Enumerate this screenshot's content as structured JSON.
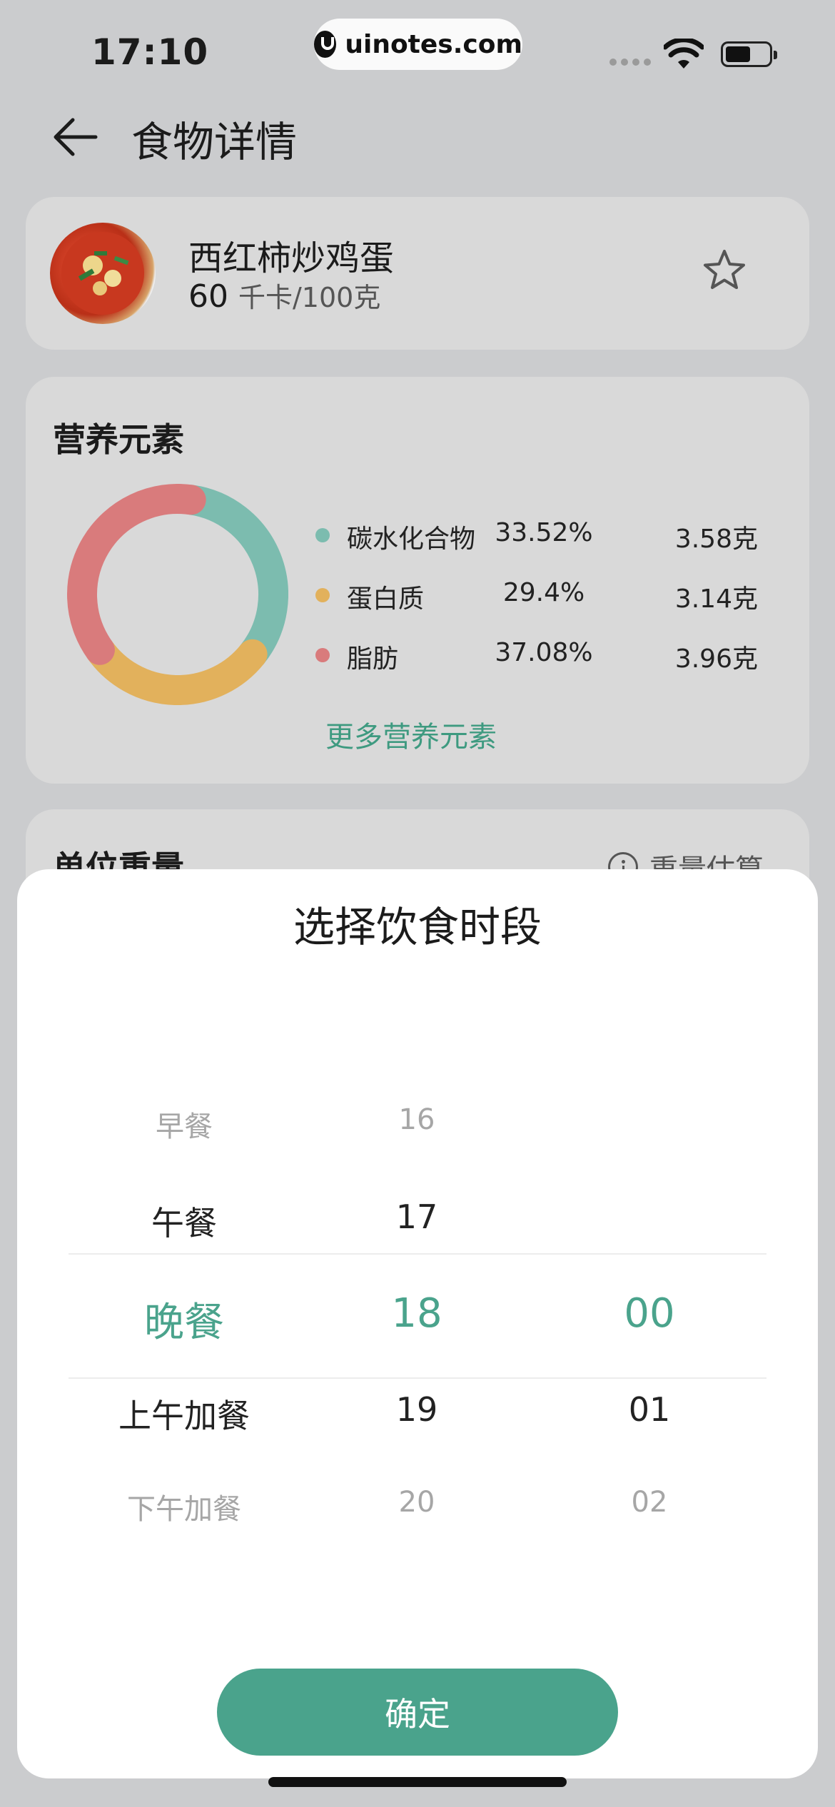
{
  "status_bar": {
    "time": "17:10",
    "site": "uinotes.com"
  },
  "header": {
    "title": "食物详情"
  },
  "food": {
    "name": "西红柿炒鸡蛋",
    "kcal": "60",
    "kcal_unit": "千卡/100克"
  },
  "nutrition": {
    "title": "营养元素",
    "items": [
      {
        "name": "碳水化合物",
        "percent": "33.52%",
        "grams": "3.58克",
        "color": "#7cbcaf"
      },
      {
        "name": "蛋白质",
        "percent": "29.4%",
        "grams": "3.14克",
        "color": "#e2b15c"
      },
      {
        "name": "脂肪",
        "percent": "37.08%",
        "grams": "3.96克",
        "color": "#d97b7c"
      }
    ],
    "more_link": "更多营养元素"
  },
  "unit_section": {
    "title": "单位重量",
    "estimate": "重量估算"
  },
  "picker": {
    "title": "选择饮食时段",
    "meals": [
      "早餐",
      "午餐",
      "晚餐",
      "上午加餐",
      "下午加餐"
    ],
    "hours": [
      "16",
      "17",
      "18",
      "19",
      "20"
    ],
    "minutes": [
      "00",
      "01",
      "02"
    ],
    "confirm": "确定"
  },
  "colors": {
    "accent": "#4aa38c",
    "background": "#cbccce",
    "card": "#d9d9d9"
  }
}
